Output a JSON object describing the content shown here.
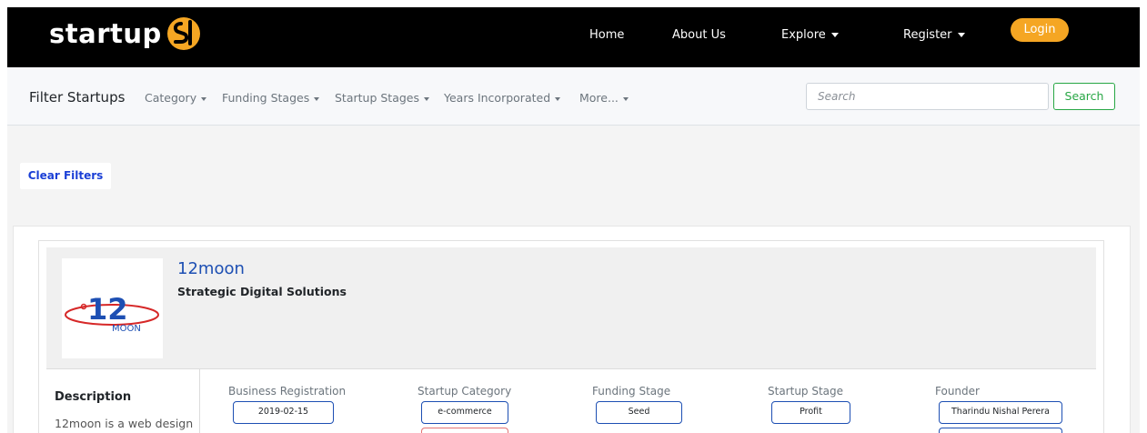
{
  "brand": {
    "name": "startup",
    "accent": "#f5a623"
  },
  "nav": {
    "home": "Home",
    "about": "About Us",
    "explore": "Explore",
    "register": "Register",
    "login": "Login"
  },
  "filters": {
    "title": "Filter Startups",
    "items": [
      "Category",
      "Funding Stages",
      "Startup Stages",
      "Years Incorporated",
      "More..."
    ],
    "search_placeholder": "Search",
    "search_button": "Search",
    "clear_button": "Clear Filters"
  },
  "startup": {
    "name": "12moon",
    "tagline": "Strategic Digital Solutions",
    "logo_text": "MOON",
    "logo_number": "12",
    "description_title": "Description",
    "description_text": "12moon is a web design",
    "meta": [
      {
        "label": "Business Registration",
        "value": "2019-02-15"
      },
      {
        "label": "Startup Category",
        "value": "e-commerce"
      },
      {
        "label": "Funding Stage",
        "value": "Seed"
      },
      {
        "label": "Startup Stage",
        "value": "Profit"
      },
      {
        "label": "Founder",
        "value": "Tharindu Nishal Perera"
      }
    ]
  },
  "colors": {
    "navbar": "#000000",
    "link_blue": "#1d4fb3",
    "search_green": "#28a745",
    "tag_red": "#e57373"
  }
}
